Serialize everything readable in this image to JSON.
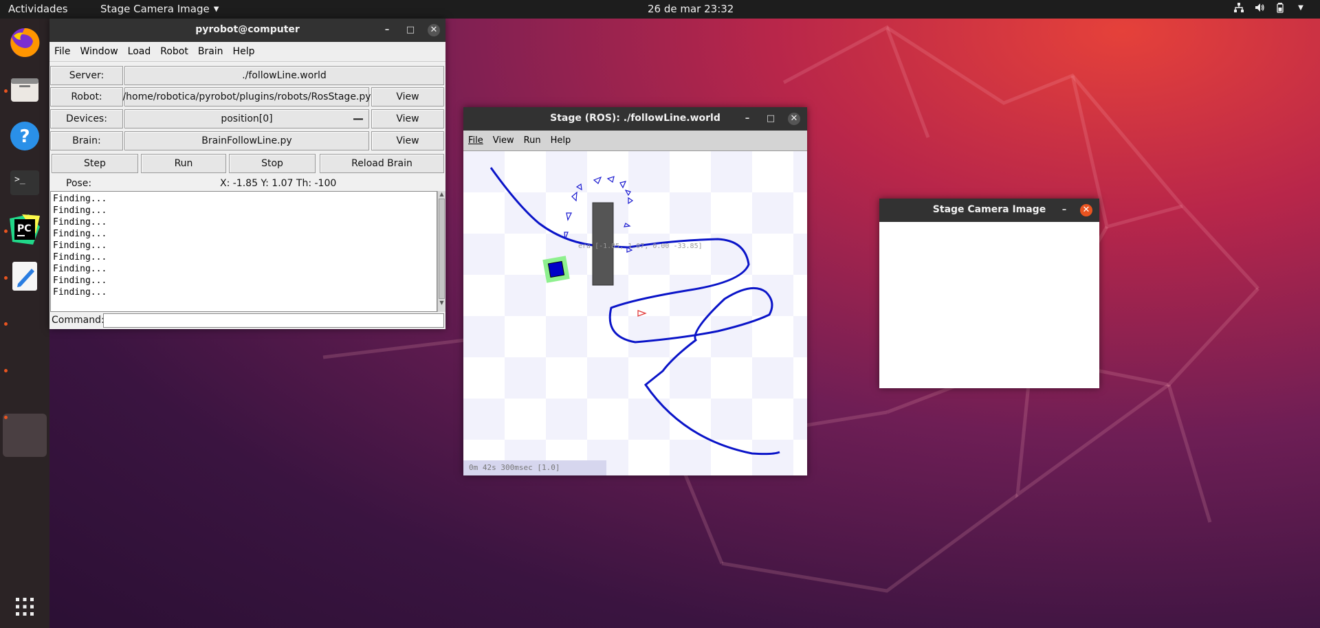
{
  "topbar": {
    "activities": "Actividades",
    "app_menu": "Stage Camera Image",
    "clock": "26 de mar  23:32",
    "tray_icons": [
      "network-icon",
      "volume-icon",
      "battery-icon",
      "chevron-down-icon"
    ]
  },
  "dock": {
    "items": [
      "firefox-icon",
      "files-icon",
      "help-icon",
      "terminal-icon",
      "pycharm-icon",
      "text-editor-icon"
    ],
    "apps_grid": "apps-grid-icon"
  },
  "pyrobot": {
    "title": "pyrobot@computer",
    "menu": [
      "File",
      "Window",
      "Load",
      "Robot",
      "Brain",
      "Help"
    ],
    "server_label": "Server:",
    "server_value": "./followLine.world",
    "robot_label": "Robot:",
    "robot_value": "/home/robotica/pyrobot/plugins/robots/RosStage.py",
    "devices_label": "Devices:",
    "devices_value": "position[0]",
    "brain_label": "Brain:",
    "brain_value": "BrainFollowLine.py",
    "view_label": "View",
    "buttons": [
      "Step",
      "Run",
      "Stop",
      "Reload Brain"
    ],
    "pose_label": "Pose:",
    "pose_value": "X: -1.85 Y: 1.07 Th: -100",
    "log": [
      "Finding...",
      "Finding...",
      "Finding...",
      "Finding...",
      "Finding...",
      "Finding...",
      "Finding...",
      "Finding...",
      "Finding..."
    ],
    "command_label": "Command:"
  },
  "stage": {
    "title": "Stage (ROS): ./followLine.world",
    "menu": [
      "File",
      "View",
      "Run",
      "Help"
    ],
    "status": "0m 42s 300msec [1.0]",
    "overlay_text": "era [-1.85, 1.07, 0.00 -33.85]"
  },
  "camera": {
    "title": "Stage Camera Image"
  },
  "colors": {
    "accent": "#e95420",
    "line": "#0a14c8",
    "titlebar": "#323232"
  }
}
